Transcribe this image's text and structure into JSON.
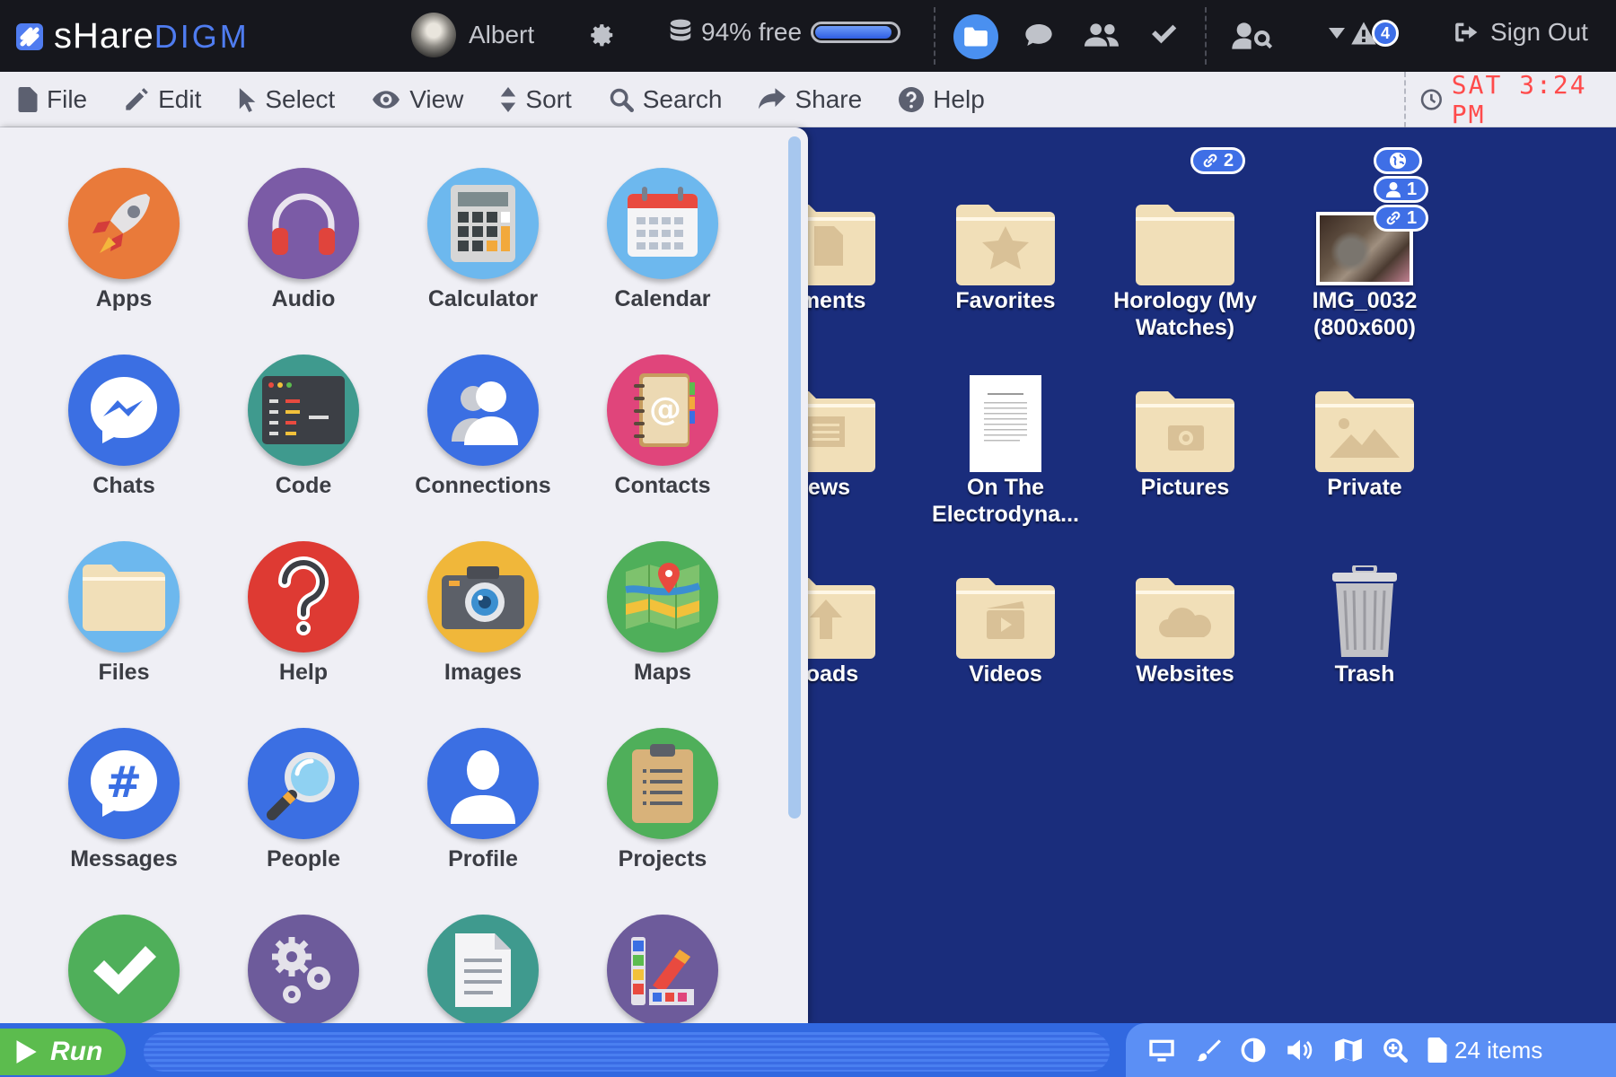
{
  "brand": {
    "part1": "sHare",
    "part2": "DIGM"
  },
  "topbar": {
    "username": "Albert",
    "storage_text": "94% free",
    "storage_level": 0.94,
    "alert_count": "4",
    "signout_label": "Sign Out"
  },
  "menubar": {
    "items": [
      "File",
      "Edit",
      "Select",
      "View",
      "Sort",
      "Search",
      "Share",
      "Help"
    ],
    "clock": "SAT 3:24 PM"
  },
  "launcher": {
    "apps": [
      {
        "label": "Apps",
        "icon": "rocket-icon"
      },
      {
        "label": "Audio",
        "icon": "headphones-icon"
      },
      {
        "label": "Calculator",
        "icon": "calculator-icon"
      },
      {
        "label": "Calendar",
        "icon": "calendar-icon"
      },
      {
        "label": "Chats",
        "icon": "messenger-icon"
      },
      {
        "label": "Code",
        "icon": "code-icon"
      },
      {
        "label": "Connections",
        "icon": "connections-icon"
      },
      {
        "label": "Contacts",
        "icon": "address-book-icon"
      },
      {
        "label": "Files",
        "icon": "folder-icon"
      },
      {
        "label": "Help",
        "icon": "question-icon"
      },
      {
        "label": "Images",
        "icon": "camera-icon"
      },
      {
        "label": "Maps",
        "icon": "map-icon"
      },
      {
        "label": "Messages",
        "icon": "hashtag-icon"
      },
      {
        "label": "People",
        "icon": "magnifier-icon"
      },
      {
        "label": "Profile",
        "icon": "person-icon"
      },
      {
        "label": "Projects",
        "icon": "clipboard-icon"
      },
      {
        "label": "",
        "icon": "checkmark-icon"
      },
      {
        "label": "",
        "icon": "gears-icon"
      },
      {
        "label": "",
        "icon": "document-icon"
      },
      {
        "label": "",
        "icon": "palette-icon"
      }
    ]
  },
  "desktop": {
    "items": [
      {
        "label": "uments",
        "icon": "document-folder-icon"
      },
      {
        "label": "Favorites",
        "icon": "star-folder-icon"
      },
      {
        "label": "Horology (My Watches)",
        "icon": "folder-icon",
        "badges": [
          "2"
        ]
      },
      {
        "label": "IMG_0032 (800x600)",
        "icon": "image-thumbnail-icon",
        "badges": [
          "",
          "1",
          "1"
        ]
      },
      {
        "label": "lews",
        "icon": "news-folder-icon"
      },
      {
        "label": "On The Electrodyna...",
        "icon": "pdf-document-icon"
      },
      {
        "label": "Pictures",
        "icon": "photo-folder-icon"
      },
      {
        "label": "Private",
        "icon": "image-folder-icon"
      },
      {
        "label": "lloads",
        "icon": "upload-folder-icon"
      },
      {
        "label": "Videos",
        "icon": "video-folder-icon"
      },
      {
        "label": "Websites",
        "icon": "cloud-folder-icon"
      },
      {
        "label": "Trash",
        "icon": "trash-icon"
      }
    ]
  },
  "bottombar": {
    "run_label": "Run",
    "item_count": "24 items"
  },
  "colors": {
    "accent": "#3168e0",
    "desktop": "#1a2d7c",
    "clock": "#ff4b4b",
    "run": "#5cbc4e"
  }
}
